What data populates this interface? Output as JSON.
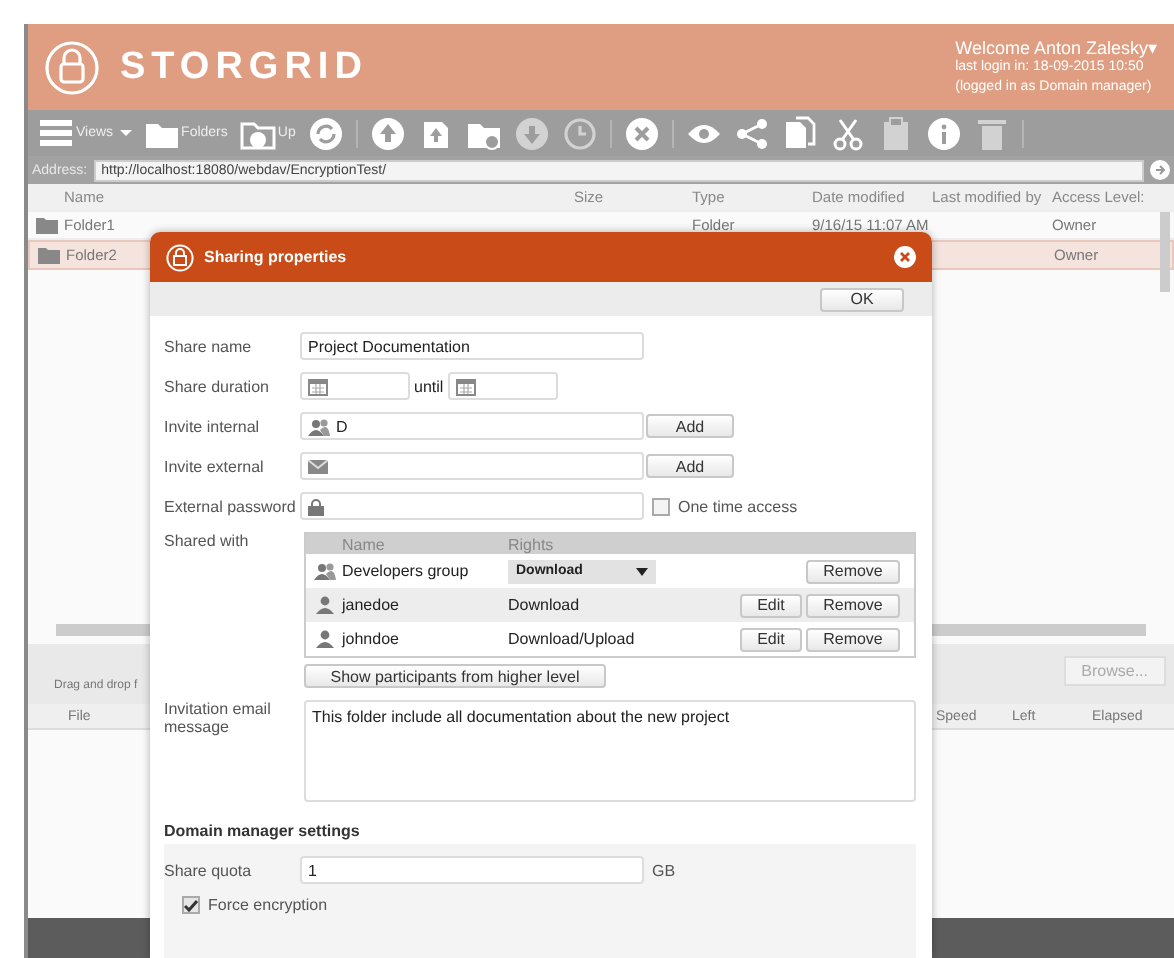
{
  "header": {
    "logo": "STORGRID",
    "welcome": "Welcome Anton Zalesky▾",
    "last_login": "last login in: 18-09-2015 10:50",
    "role": "(logged in as Domain manager)"
  },
  "toolbar": [
    {
      "kind": "views",
      "label": "Views",
      "disabled": false
    },
    {
      "kind": "folders",
      "label": "Folders",
      "disabled": false
    },
    {
      "kind": "up",
      "label": "Up",
      "disabled": false
    },
    {
      "kind": "refresh",
      "disabled": false
    },
    {
      "kind": "upload",
      "disabled": false
    },
    {
      "kind": "upload-file",
      "disabled": false
    },
    {
      "kind": "new-folder",
      "disabled": false
    },
    {
      "kind": "download",
      "disabled": true
    },
    {
      "kind": "history",
      "disabled": true
    },
    {
      "kind": "delete",
      "disabled": false
    },
    {
      "kind": "view",
      "disabled": false
    },
    {
      "kind": "share",
      "disabled": false
    },
    {
      "kind": "copy",
      "disabled": false
    },
    {
      "kind": "cut",
      "disabled": false
    },
    {
      "kind": "paste",
      "disabled": true
    },
    {
      "kind": "info",
      "disabled": false
    },
    {
      "kind": "trash",
      "disabled": true
    }
  ],
  "address": {
    "label": "Address:",
    "value": "http://localhost:18080/webdav/EncryptionTest/"
  },
  "files": {
    "columns": [
      "Name",
      "Size",
      "Type",
      "Date modified",
      "Last modified by",
      "Access Level:"
    ],
    "rows": [
      {
        "name": "Folder1",
        "type": "Folder",
        "date": "9/16/15 11:07 AM",
        "access": "Owner",
        "selected": false
      },
      {
        "name": "Folder2",
        "access": "Owner",
        "selected": true
      }
    ]
  },
  "upload": {
    "hint": "Drag and drop f",
    "browse": "Browse...",
    "columns": [
      "File",
      "Speed",
      "Left",
      "Elapsed"
    ]
  },
  "dialog": {
    "title": "Sharing properties",
    "ok": "OK",
    "share_name": {
      "label": "Share name",
      "value": "Project Documentation"
    },
    "duration": {
      "label": "Share duration",
      "until": "until"
    },
    "invite_internal": {
      "label": "Invite internal",
      "value": "D",
      "button": "Add"
    },
    "invite_external": {
      "label": "Invite external",
      "button": "Add"
    },
    "password": {
      "label": "External password",
      "option": "One time access",
      "checked": false
    },
    "shared_with": {
      "label": "Shared with",
      "columns": [
        "Name",
        "Rights"
      ],
      "rows": [
        {
          "kind": "group",
          "name": "Developers group",
          "rights": "Download",
          "remove": "Remove",
          "selected": false
        },
        {
          "kind": "user",
          "name": "janedoe",
          "rights": "Download",
          "edit": "Edit",
          "remove": "Remove",
          "selected": true
        },
        {
          "kind": "user",
          "name": "johndoe",
          "rights": "Download/Upload",
          "edit": "Edit",
          "remove": "Remove",
          "selected": false
        }
      ],
      "more": "Show participants from higher level"
    },
    "message": {
      "label": "Invitation email message",
      "value": "This folder include all documentation about the new project"
    },
    "domain": {
      "title": "Domain manager settings",
      "quota_label": "Share quota",
      "quota": "1",
      "unit": "GB",
      "encryption": "Force encryption",
      "checked": true
    }
  }
}
